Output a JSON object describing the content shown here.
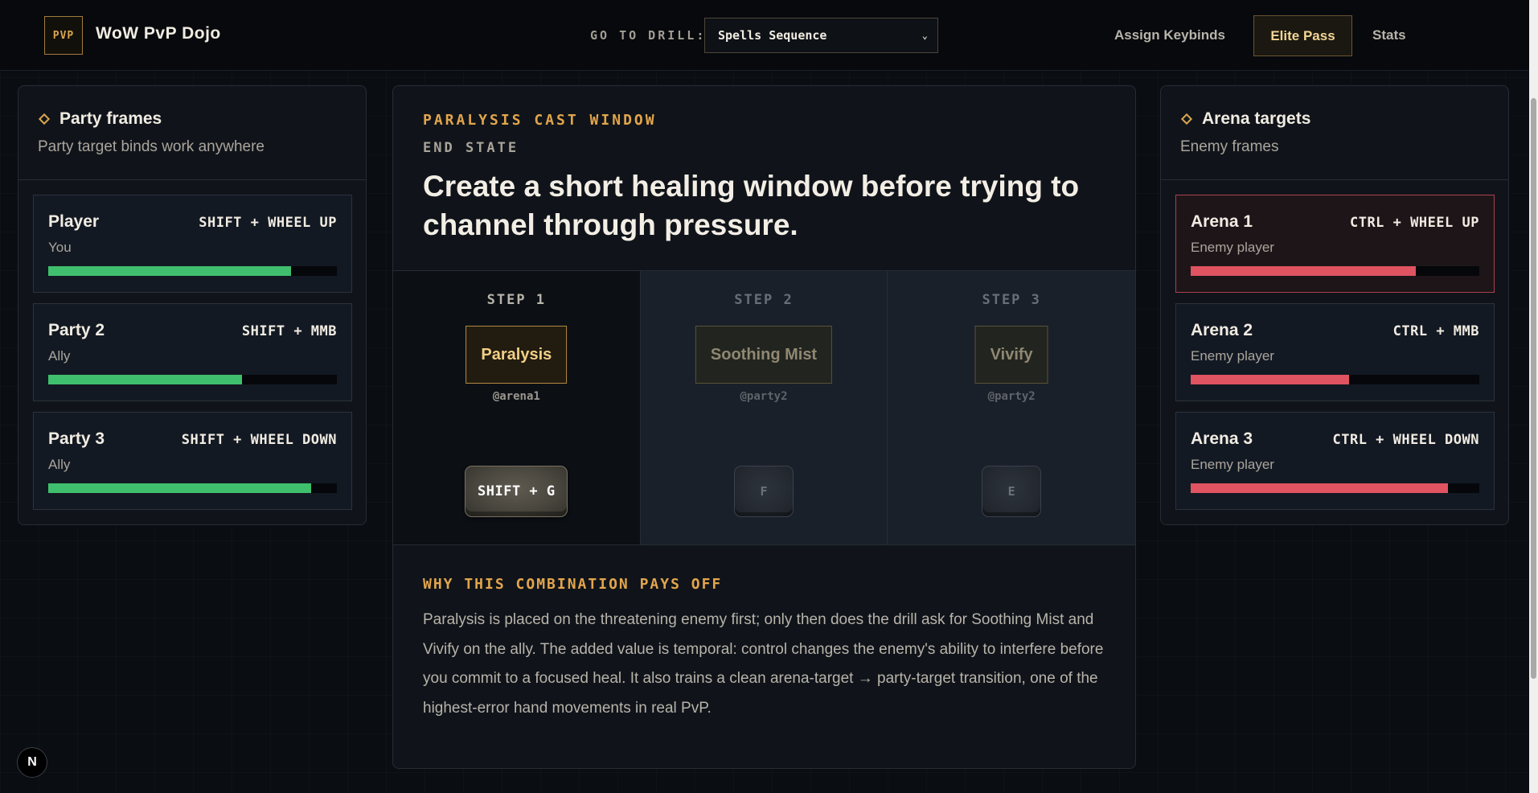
{
  "header": {
    "logo_text": "PVP",
    "app_title": "WoW PvP Dojo",
    "drill_label": "GO TO DRILL:",
    "drill_selected": "Spells Sequence",
    "nav": {
      "assign_keybinds": "Assign Keybinds",
      "elite_pass": "Elite Pass",
      "stats": "Stats"
    }
  },
  "party_panel": {
    "title": "Party frames",
    "subtitle": "Party target binds work anywhere",
    "frames": [
      {
        "name": "Player",
        "keybind": "SHIFT + WHEEL UP",
        "role": "You",
        "health": 0.84
      },
      {
        "name": "Party 2",
        "keybind": "SHIFT + MMB",
        "role": "Ally",
        "health": 0.67
      },
      {
        "name": "Party 3",
        "keybind": "SHIFT + WHEEL DOWN",
        "role": "Ally",
        "health": 0.91
      }
    ]
  },
  "arena_panel": {
    "title": "Arena targets",
    "subtitle": "Enemy frames",
    "frames": [
      {
        "name": "Arena 1",
        "keybind": "CTRL + WHEEL UP",
        "role": "Enemy player",
        "health": 0.78,
        "highlighted": true
      },
      {
        "name": "Arena 2",
        "keybind": "CTRL + MMB",
        "role": "Enemy player",
        "health": 0.55
      },
      {
        "name": "Arena 3",
        "keybind": "CTRL + WHEEL DOWN",
        "role": "Enemy player",
        "health": 0.89
      }
    ]
  },
  "drill": {
    "eyebrow": "PARALYSIS CAST WINDOW",
    "end_state_label": "END STATE",
    "headline": "Create a short healing window before trying to channel through pressure.",
    "steps": [
      {
        "label": "STEP 1",
        "spell": "Paralysis",
        "target": "@arena1",
        "key": "SHIFT + G",
        "state": "active"
      },
      {
        "label": "STEP 2",
        "spell": "Soothing Mist",
        "target": "@party2",
        "key": "F",
        "state": "pending"
      },
      {
        "label": "STEP 3",
        "spell": "Vivify",
        "target": "@party2",
        "key": "E",
        "state": "pending"
      }
    ],
    "why_title": "WHY THIS COMBINATION PAYS OFF",
    "why_body": "Paralysis is placed on the threatening enemy first; only then does the drill ask for Soothing Mist and Vivify on the ally. The added value is temporal: control changes the enemy's ability to interfere before you commit to a focused heal. It also trains a clean arena-target → party-target transition, one of the highest-error hand movements in real PvP."
  },
  "corner_badge": "N",
  "colors": {
    "accent_gold": "#e2a54c",
    "ally_health": "#3fbf6d",
    "enemy_health": "#e05361",
    "highlight_border": "#a8414c"
  }
}
